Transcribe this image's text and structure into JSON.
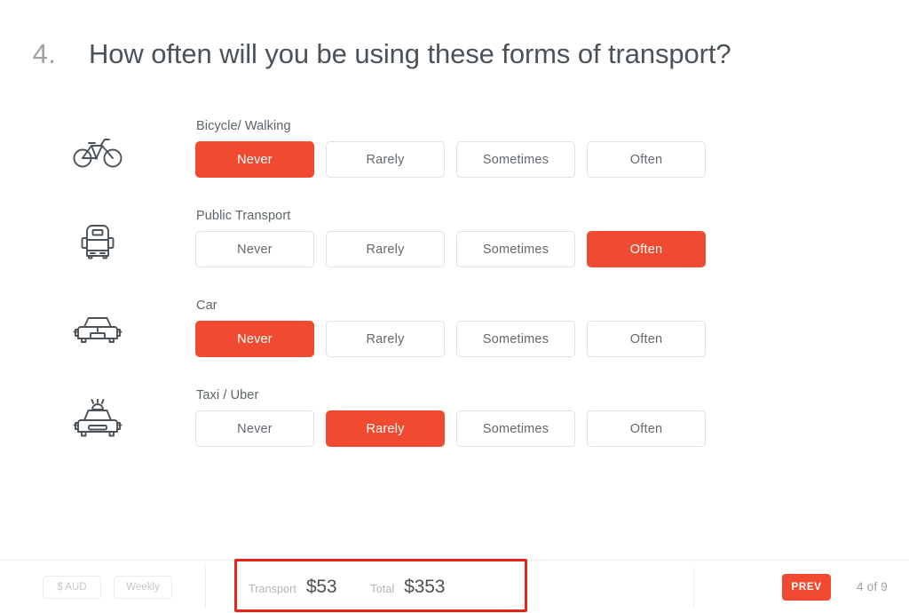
{
  "question": {
    "number": "4.",
    "title": "How often will you be using these forms of transport?"
  },
  "options_labels": [
    "Never",
    "Rarely",
    "Sometimes",
    "Often"
  ],
  "rows": [
    {
      "label": "Bicycle/ Walking",
      "icon": "bicycle-icon",
      "options": [
        {
          "label": "Never",
          "selected": true
        },
        {
          "label": "Rarely",
          "selected": false
        },
        {
          "label": "Sometimes",
          "selected": false
        },
        {
          "label": "Often",
          "selected": false
        }
      ]
    },
    {
      "label": "Public Transport",
      "icon": "bus-icon",
      "options": [
        {
          "label": "Never",
          "selected": false
        },
        {
          "label": "Rarely",
          "selected": false
        },
        {
          "label": "Sometimes",
          "selected": false
        },
        {
          "label": "Often",
          "selected": true
        }
      ]
    },
    {
      "label": "Car",
      "icon": "car-icon",
      "options": [
        {
          "label": "Never",
          "selected": true
        },
        {
          "label": "Rarely",
          "selected": false
        },
        {
          "label": "Sometimes",
          "selected": false
        },
        {
          "label": "Often",
          "selected": false
        }
      ]
    },
    {
      "label": "Taxi / Uber",
      "icon": "taxi-icon",
      "options": [
        {
          "label": "Never",
          "selected": false
        },
        {
          "label": "Rarely",
          "selected": true
        },
        {
          "label": "Sometimes",
          "selected": false
        },
        {
          "label": "Often",
          "selected": false
        }
      ]
    }
  ],
  "footer": {
    "currency_select": "$ AUD",
    "period_select": "Weekly",
    "transport_label": "Transport",
    "transport_value": "$53",
    "total_label": "Total",
    "total_value": "$353",
    "prev_button": "PREV",
    "page_count": "4 of 9"
  },
  "colors": {
    "accent_red": "#f04b30",
    "annotation_red": "#e8251a",
    "text_dark": "#4c5358",
    "text_muted": "#9aa1a8",
    "border_light": "#dfe1e3"
  }
}
